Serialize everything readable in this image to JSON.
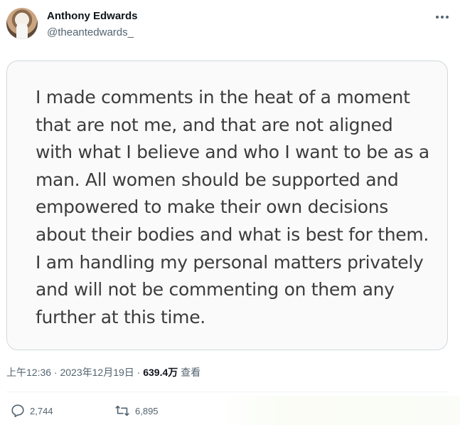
{
  "tweet": {
    "author_name": "Anthony Edwards",
    "author_handle": "@theantedwards_",
    "more_icon": "more-horizontal-icon",
    "image_text": "I made comments in the heat of a moment that are not me, and that are not aligned with what I believe and who I want to be as a man. All women should be supported and empowered to make their own decisions about their bodies and what is best for them. I am handling my personal matters privately and will not be commenting on them any further at this time.",
    "timestamp": "上午12:36 · 2023年12月19日 · ",
    "views_count": "639.4万",
    "views_label": " 查看"
  },
  "actions": {
    "reply_icon": "reply-icon",
    "reply_count": "2,744",
    "retweet_icon": "retweet-icon",
    "retweet_count": "6,895"
  },
  "colors": {
    "text_primary": "#0f1419",
    "text_secondary": "#536471",
    "border": "#cfd9de",
    "image_text": "#3c3c3c"
  }
}
